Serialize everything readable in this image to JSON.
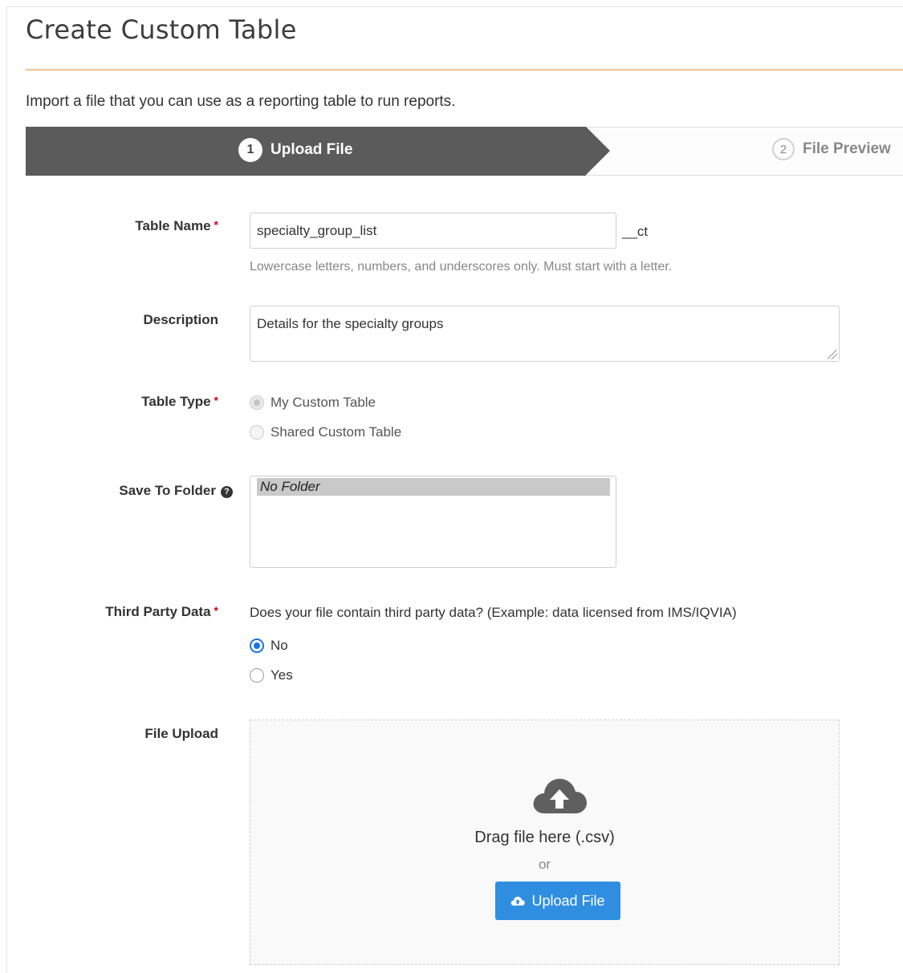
{
  "page": {
    "title": "Create Custom Table",
    "intro": "Import a file that you can use as a reporting table to run reports."
  },
  "stepper": {
    "steps": [
      {
        "number": "1",
        "label": "Upload File",
        "active": true
      },
      {
        "number": "2",
        "label": "File Preview",
        "active": false
      }
    ]
  },
  "form": {
    "table_name": {
      "label": "Table Name",
      "required_mark": "*",
      "value": "specialty_group_list",
      "suffix": "__ct",
      "help": "Lowercase letters, numbers, and underscores only. Must start with a letter."
    },
    "description": {
      "label": "Description",
      "value": "Details for the specialty groups"
    },
    "table_type": {
      "label": "Table Type",
      "required_mark": "*",
      "options": [
        "My Custom Table",
        "Shared Custom Table"
      ],
      "selected": "My Custom Table",
      "disabled": true
    },
    "save_to_folder": {
      "label": "Save To Folder",
      "help_icon": "?",
      "items": [
        "No Folder"
      ],
      "selected": "No Folder"
    },
    "third_party": {
      "label": "Third Party Data",
      "required_mark": "*",
      "question": "Does your file contain third party data? (Example: data licensed from IMS/IQVIA)",
      "options": [
        "No",
        "Yes"
      ],
      "selected": "No"
    },
    "file_upload": {
      "label": "File Upload",
      "drag_text": "Drag file here (.csv)",
      "or_text": "or",
      "button_label": "Upload File"
    }
  },
  "colors": {
    "accent_rule": "#f1c48e",
    "step_active_bg": "#5b5b5b",
    "required": "#d0021b",
    "primary_button": "#2f8ee0",
    "radio_selected": "#1a73e8"
  },
  "icons": [
    "question-circle-icon",
    "cloud-upload-icon",
    "cloud-upload-small-icon",
    "resize-grip-icon"
  ]
}
